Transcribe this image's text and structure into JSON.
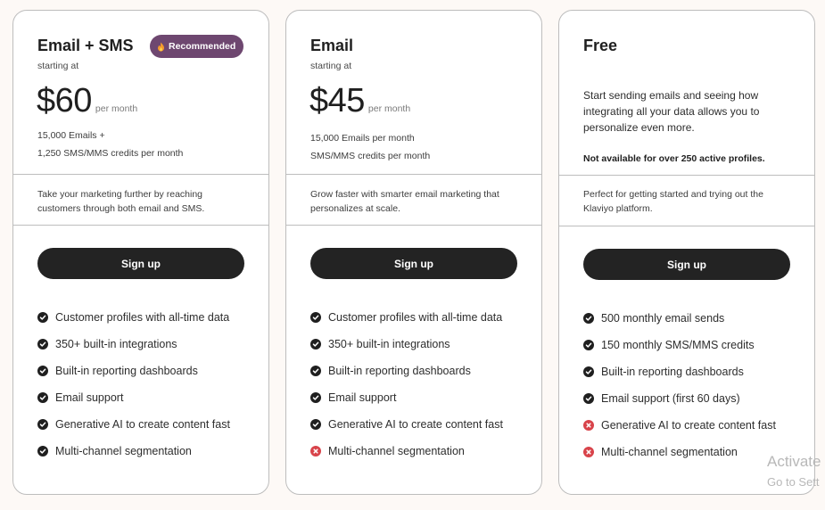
{
  "plans": [
    {
      "name": "Email + SMS",
      "badge": "Recommended",
      "starting_at": "starting at",
      "price": "$60",
      "per_month": "per month",
      "details": [
        "15,000 Emails +",
        "1,250 SMS/MMS credits per month"
      ],
      "blurb": "Take your marketing further by reaching customers through both email and SMS.",
      "cta": "Sign up",
      "features": [
        {
          "label": "Customer profiles with all-time data",
          "included": true
        },
        {
          "label": "350+ built-in integrations",
          "included": true
        },
        {
          "label": "Built-in reporting dashboards",
          "included": true
        },
        {
          "label": "Email support",
          "included": true
        },
        {
          "label": "Generative AI to create content fast",
          "included": true
        },
        {
          "label": "Multi-channel segmentation",
          "included": true
        }
      ]
    },
    {
      "name": "Email",
      "starting_at": "starting at",
      "price": "$45",
      "per_month": "per month",
      "details": [
        "15,000 Emails per month",
        "SMS/MMS credits per month"
      ],
      "blurb": "Grow faster with smarter email marketing that personalizes at scale.",
      "cta": "Sign up",
      "features": [
        {
          "label": "Customer profiles with all-time data",
          "included": true
        },
        {
          "label": "350+ built-in integrations",
          "included": true
        },
        {
          "label": "Built-in reporting dashboards",
          "included": true
        },
        {
          "label": "Email support",
          "included": true
        },
        {
          "label": "Generative AI to create content fast",
          "included": true
        },
        {
          "label": "Multi-channel segmentation",
          "included": false
        }
      ]
    },
    {
      "name": "Free",
      "description": "Start sending emails and seeing how integrating all your data allows you to personalize even more.",
      "note": "Not available for over 250 active profiles.",
      "blurb": "Perfect for getting started and trying out the Klaviyo platform.",
      "cta": "Sign up",
      "features": [
        {
          "label": "500 monthly email sends",
          "included": true
        },
        {
          "label": "150 monthly SMS/MMS credits",
          "included": true
        },
        {
          "label": "Built-in reporting dashboards",
          "included": true
        },
        {
          "label": "Email support (first 60 days)",
          "included": true
        },
        {
          "label": "Generative AI to create content fast",
          "included": false
        },
        {
          "label": "Multi-channel segmentation",
          "included": false
        }
      ]
    }
  ],
  "icons": {
    "included": "check-circle-icon",
    "excluded": "x-circle-icon",
    "badge": "flame-icon"
  },
  "colors": {
    "primary_button": "#232323",
    "badge": "#6e4770",
    "check": "#1f1f1f",
    "cross": "#d8434a",
    "background": "#fdf9f6"
  },
  "watermark": {
    "line1": "Activate",
    "line2": "Go to Sett"
  }
}
